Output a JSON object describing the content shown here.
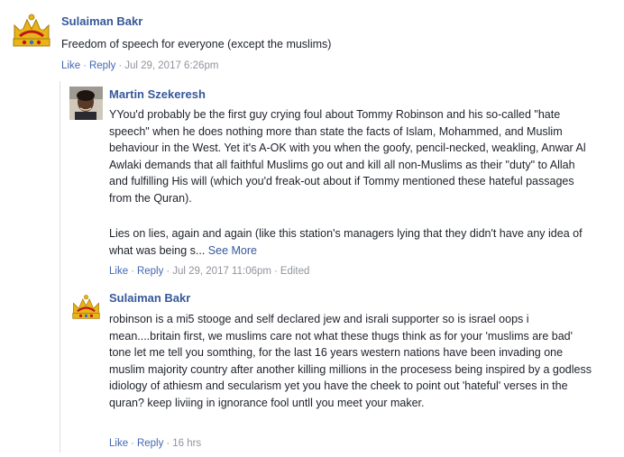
{
  "comments": [
    {
      "author": "Sulaiman Bakr",
      "text": "Freedom of speech for everyone (except the muslims)",
      "like_label": "Like",
      "reply_label": "Reply",
      "time": "Jul 29, 2017 6:26pm",
      "avatar": "crown-avatar"
    },
    {
      "author": "Martin Szekeresh",
      "paragraph1": "YYou'd probably be the first guy crying foul about Tommy Robinson and his so-called \"hate speech\" when he does nothing more than state the facts of Islam, Mohammed, and Muslim behaviour in the West. Yet it's A-OK with you when the goofy, pencil-necked, weakling, Anwar Al Awlaki demands that all faithful Muslims go out and kill all non-Muslims as their \"duty\" to Allah and fulfilling His will (which you'd freak-out about if Tommy mentioned these hateful passages from the Quran).",
      "paragraph2": "Lies on lies, again and again (like this station's managers lying that they didn't have any idea of what was being s...",
      "see_more": "See More",
      "like_label": "Like",
      "reply_label": "Reply",
      "time": "Jul 29, 2017 11:06pm",
      "edited": "Edited",
      "avatar": "photo-avatar"
    },
    {
      "author": "Sulaiman Bakr",
      "text": "robinson is a mi5 stooge and self declared jew and israli supporter so is israel oops i mean....britain first, we muslims care not what these thugs think as for your 'muslims are bad' tone let me tell you somthing, for the last 16 years western nations have been invading one muslim majority country after another killing millions in the procesess being inspired by a godless idiology of athiesm and secularism yet you have the cheek to point out 'hateful' verses in the quran? keep liviing in ignorance fool untll you meet your maker.",
      "like_label": "Like",
      "reply_label": "Reply",
      "time": "16 hrs",
      "avatar": "crown-avatar"
    }
  ],
  "colors": {
    "author": "#365899",
    "link": "#4267b2",
    "meta": "#90949c",
    "text": "#1d2129",
    "crown_gold": "#e8b418",
    "crown_red": "#c0141b"
  }
}
